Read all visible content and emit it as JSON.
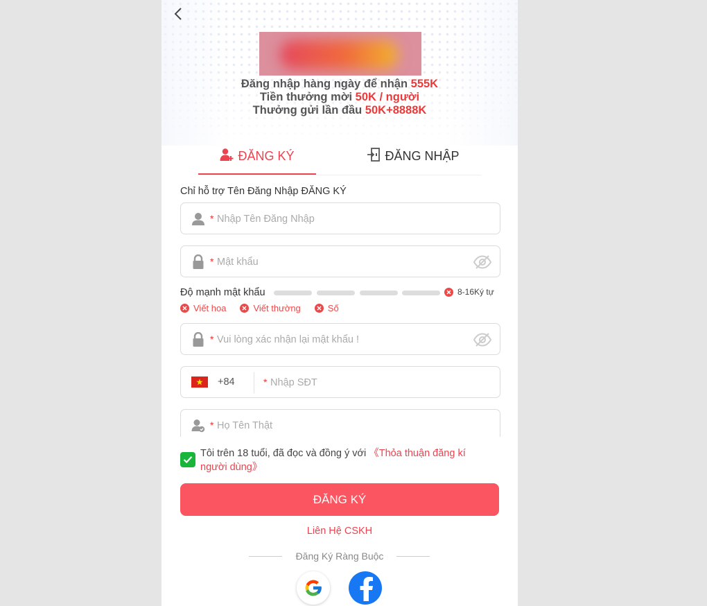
{
  "promo": {
    "line1_text": "Đăng nhập hàng ngày để nhận ",
    "line1_value": "555K",
    "line2_text": "Tiền thưởng mời ",
    "line2_value": "50K / người",
    "line3_text": "Thưởng gửi lần đầu ",
    "line3_value": "50K+8888K"
  },
  "tabs": {
    "register": "ĐĂNG KÝ",
    "login": "ĐĂNG NHẬP",
    "active": "register"
  },
  "form": {
    "support_note": "Chỉ hỗ trợ Tên Đăng Nhập ĐĂNG KÝ",
    "required_mark": "*",
    "username_placeholder": "Nhập Tên Đăng Nhập",
    "password_placeholder": "Mật khẩu",
    "confirm_placeholder": "Vui lòng xác nhận lại mật khẩu !",
    "phone_code": "+84",
    "phone_placeholder": "Nhập SĐT",
    "realname_placeholder": "Họ Tên Thật"
  },
  "strength": {
    "label": "Độ mạnh mật khẩu",
    "filled_bars": 0,
    "total_bars": 4,
    "length_rule": "8-16Ký tự",
    "rules": [
      "Viết hoa",
      "Viết thường",
      "Số"
    ]
  },
  "agreement": {
    "checked": true,
    "text": "Tôi trên 18 tuổi, đã đọc và đồng ý với ",
    "link": "《Thỏa thuận đăng kí người dùng》"
  },
  "submit_label": "ĐĂNG KÝ",
  "contact_label": "Liên Hệ CSKH",
  "bind_label": "Đăng Ký Ràng Buộc",
  "social": [
    "google-icon",
    "facebook-icon"
  ],
  "colors": {
    "accent": "#fa5560",
    "error": "#e94a4a",
    "checkbox": "#17b53a",
    "facebook": "#1877f2"
  }
}
